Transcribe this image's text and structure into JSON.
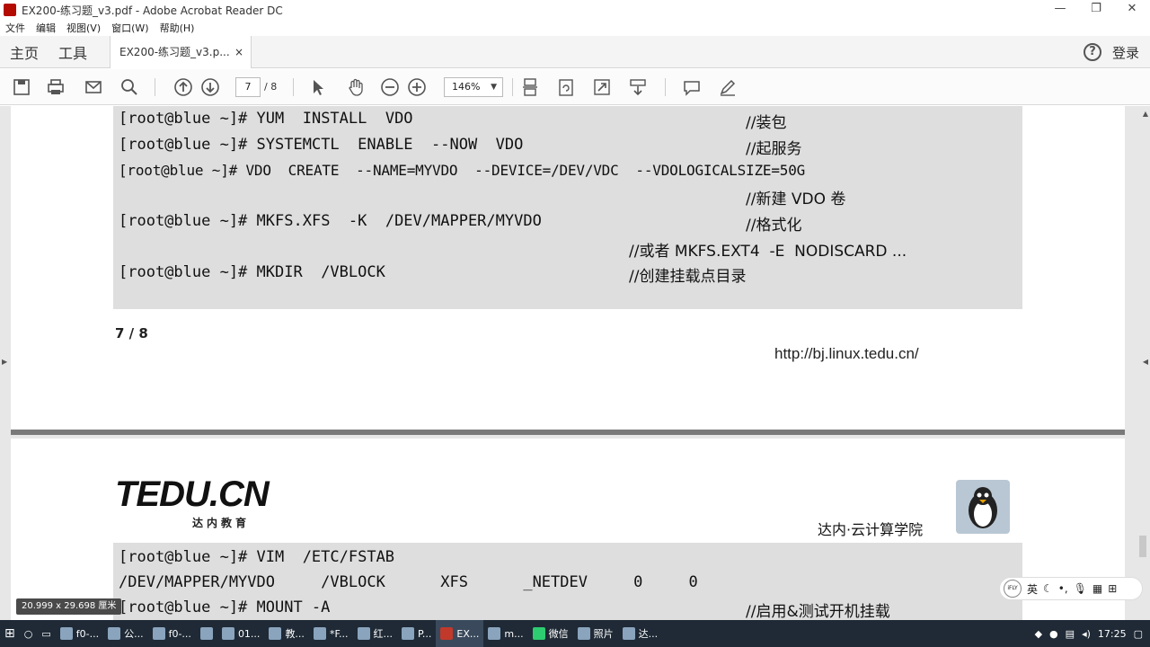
{
  "window": {
    "title": "EX200-练习题_v3.pdf - Adobe Acrobat Reader DC",
    "buttons": [
      "—",
      "❐",
      "✕"
    ]
  },
  "menu": [
    "文件",
    "编辑",
    "视图(V)",
    "窗口(W)",
    "帮助(H)"
  ],
  "tabs": {
    "home": "主页",
    "tools": "工具",
    "doc_tab": "EX200-练习题_v3.p...",
    "doc_close": "×",
    "login": "登录",
    "help": "?"
  },
  "toolbar": {
    "page_current": "7",
    "page_total": "/ 8",
    "zoom": "146%",
    "zoom_caret": "▼"
  },
  "page1": {
    "lines": [
      {
        "prompt": "[root@blue ~]#",
        "cmd": "YUM  INSTALL  VDO",
        "comment": "//装包"
      },
      {
        "prompt": "[root@blue ~]#",
        "cmd": "SYSTEMCTL  ENABLE  --NOW  VDO",
        "comment": "//起服务"
      },
      {
        "prompt": "[root@blue ~]#",
        "cmd": "VDO  CREATE  --NAME=MYVDO  --DEVICE=/DEV/VDC  --VDOLOGICALSIZE=50G",
        "comment": ""
      },
      {
        "prompt": "",
        "cmd": "",
        "comment": "//新建 VDO 卷"
      },
      {
        "prompt": "[root@blue ~]#",
        "cmd": "MKFS.XFS  -K  /DEV/MAPPER/MYVDO",
        "comment": "//格式化"
      },
      {
        "prompt": "",
        "cmd": "",
        "comment": "//或者 MKFS.EXT4  -E  NODISCARD ..."
      },
      {
        "prompt": "[root@blue ~]#",
        "cmd": "MKDIR  /VBLOCK",
        "comment": "//创建挂载点目录"
      }
    ],
    "page_number": "7 / 8",
    "url": "http://bj.linux.tedu.cn/"
  },
  "page2": {
    "logo": "TEDU.CN",
    "logo_sub": "达内教育",
    "school": "达内·云计算学院",
    "lines": [
      {
        "text": "[root@blue ~]# VIM  /ETC/FSTAB",
        "comment": ""
      },
      {
        "text": "/DEV/MAPPER/MYVDO     /VBLOCK      XFS      _NETDEV     0     0",
        "comment": ""
      },
      {
        "text": "[root@blue ~]# MOUNT -A",
        "comment": "//启用&测试开机挂载"
      }
    ]
  },
  "size_tip": "20.999 x 29.698 厘米",
  "ime": {
    "lang": "英"
  },
  "taskbar": {
    "items": [
      "f0-...",
      "公...",
      "f0-...",
      "01...",
      "教...",
      "*F...",
      "红...",
      "P...",
      "EX...",
      "m...",
      "微信",
      "照片",
      "达..."
    ],
    "clock": "17:25"
  },
  "colors": {
    "code_bg": "#dedede",
    "taskbar": "#1f2a36",
    "page_bg": "#e7e7e7"
  }
}
